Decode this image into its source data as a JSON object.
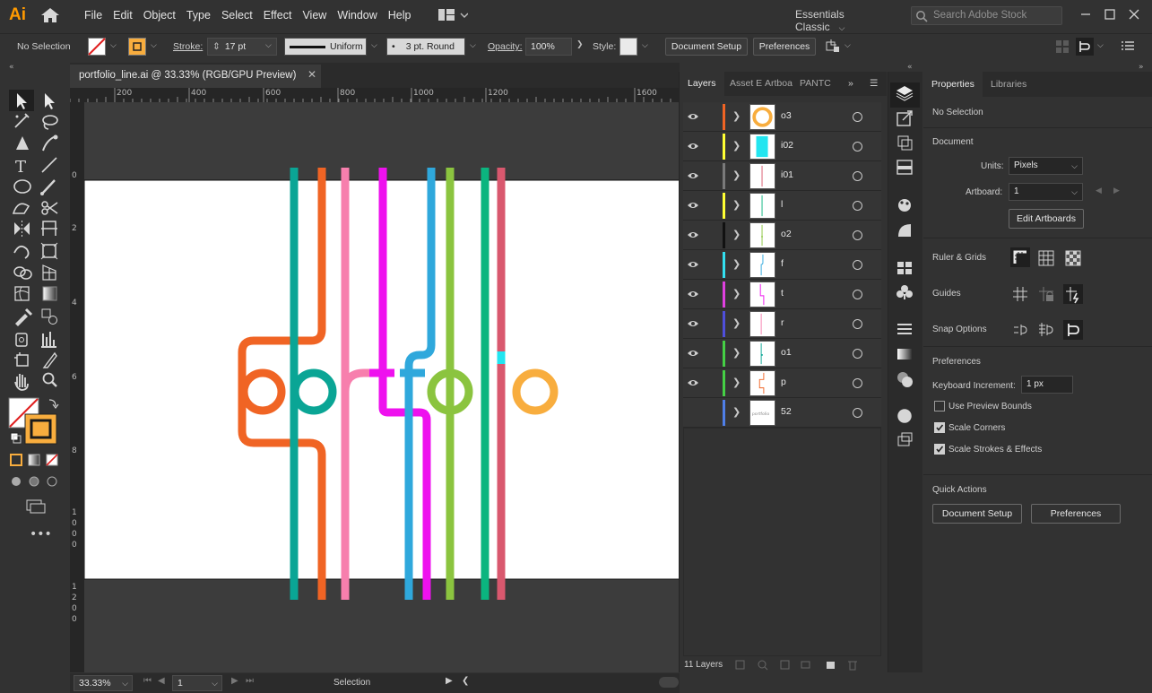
{
  "app": {
    "logo": "Ai",
    "menu": [
      "File",
      "Edit",
      "Object",
      "Type",
      "Select",
      "Effect",
      "View",
      "Window",
      "Help"
    ],
    "workspace": "Essentials Classic",
    "search_placeholder": "Search Adobe Stock"
  },
  "control_bar": {
    "selection": "No Selection",
    "stroke_label": "Stroke:",
    "stroke_value": "17 pt",
    "profile": "Uniform",
    "brush": "3 pt. Round",
    "opacity_label": "Opacity:",
    "opacity_value": "100%",
    "style_label": "Style:",
    "document_setup": "Document Setup",
    "preferences": "Preferences"
  },
  "document": {
    "tab_title": "portfolio_line.ai @ 33.33% (RGB/GPU Preview)",
    "ruler_h": [
      "200",
      "400",
      "600",
      "800",
      "1000",
      "1200",
      "1600"
    ],
    "ruler_v": [
      "0",
      "2",
      "4",
      "6",
      "8",
      "1 0 0 0",
      "1 2 0 0"
    ],
    "zoom": "33.33%",
    "artboard_number": "1",
    "status_tool": "Selection"
  },
  "layers_panel": {
    "tabs": [
      "Layers",
      "Asset E",
      "Artboa",
      "PANTC"
    ],
    "layers": [
      {
        "name": "o3",
        "color": "#f06424"
      },
      {
        "name": "i02",
        "color": "#ffff33"
      },
      {
        "name": "i01",
        "color": "#7a7a7a"
      },
      {
        "name": "l",
        "color": "#ffff33"
      },
      {
        "name": "o2",
        "color": "#111111"
      },
      {
        "name": "f",
        "color": "#33e0f0"
      },
      {
        "name": "t",
        "color": "#e040e0"
      },
      {
        "name": "r",
        "color": "#4f4fdb"
      },
      {
        "name": "o1",
        "color": "#45d045"
      },
      {
        "name": "p",
        "color": "#45d045"
      },
      {
        "name": "52",
        "color": "#4f7fe8"
      }
    ],
    "footer": "11 Layers"
  },
  "properties": {
    "tabs": [
      "Properties",
      "Libraries"
    ],
    "selection": "No Selection",
    "document_title": "Document",
    "units_label": "Units:",
    "units_value": "Pixels",
    "artboard_label": "Artboard:",
    "artboard_value": "1",
    "edit_artboards": "Edit Artboards",
    "ruler_grids": "Ruler & Grids",
    "guides": "Guides",
    "snap_options": "Snap Options",
    "preferences_title": "Preferences",
    "keyboard_increment_label": "Keyboard Increment:",
    "keyboard_increment_value": "1 px",
    "use_preview_bounds": "Use Preview Bounds",
    "scale_corners": "Scale Corners",
    "scale_strokes": "Scale Strokes & Effects",
    "quick_actions": "Quick Actions",
    "document_setup": "Document Setup",
    "preferences": "Preferences"
  },
  "colors": {
    "orange": "#f06424",
    "teal": "#0aa595",
    "pink": "#f77fad",
    "magenta": "#ee11ee",
    "blue": "#2fa8dc",
    "green": "#8bc43f",
    "emerald": "#0bb57f",
    "rose": "#d9586e",
    "cyan": "#22e5f0",
    "yellow_orange": "#f8ad3e"
  }
}
